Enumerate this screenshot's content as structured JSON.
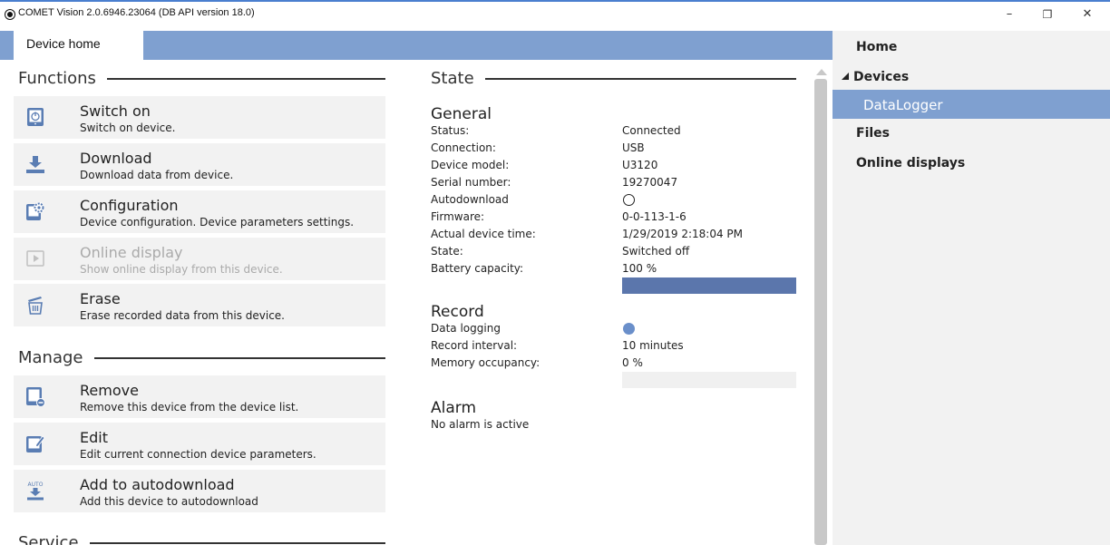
{
  "window": {
    "title": "COMET Vision 2.0.6946.23064 (DB API version 18.0)",
    "minimize_glyph": "–",
    "restore_glyph": "❐",
    "close_glyph": "✕"
  },
  "tabs": [
    {
      "label": "Device home",
      "active": true
    }
  ],
  "functions": {
    "heading": "Functions",
    "items": [
      {
        "name": "Switch on",
        "desc": "Switch on device.",
        "icon": "power-icon",
        "enabled": true
      },
      {
        "name": "Download",
        "desc": "Download data from device.",
        "icon": "download-icon",
        "enabled": true
      },
      {
        "name": "Configuration",
        "desc": "Device configuration. Device parameters settings.",
        "icon": "configuration-icon",
        "enabled": true
      },
      {
        "name": "Online display",
        "desc": "Show online display from this device.",
        "icon": "play-icon",
        "enabled": false
      },
      {
        "name": "Erase",
        "desc": "Erase recorded data from this device.",
        "icon": "erase-icon",
        "enabled": true
      }
    ]
  },
  "manage": {
    "heading": "Manage",
    "items": [
      {
        "name": "Remove",
        "desc": "Remove this device from the device list.",
        "icon": "remove-device-icon",
        "enabled": true
      },
      {
        "name": "Edit",
        "desc": "Edit current connection device parameters.",
        "icon": "edit-device-icon",
        "enabled": true
      },
      {
        "name": "Add to autodownload",
        "desc": "Add this device to autodownload",
        "icon": "autodownload-icon",
        "icon_text": "AUTO",
        "enabled": true
      }
    ]
  },
  "service": {
    "heading": "Service"
  },
  "state": {
    "heading": "State",
    "general": {
      "heading": "General",
      "status_label": "Status:",
      "status_value": "Connected",
      "connection_label": "Connection:",
      "connection_value": "USB",
      "model_label": "Device model:",
      "model_value": "U3120",
      "serial_label": "Serial number:",
      "serial_value": "19270047",
      "autodownload_label": "Autodownload",
      "autodownload_checked": false,
      "firmware_label": "Firmware:",
      "firmware_value": "0-0-113-1-6",
      "time_label": "Actual device time:",
      "time_value": "1/29/2019 2:18:04 PM",
      "state_label": "State:",
      "state_value": "Switched off",
      "battery_label": "Battery capacity:",
      "battery_value": "100 %",
      "battery_level": 1.0
    },
    "record": {
      "heading": "Record",
      "logging_label": "Data logging",
      "logging_on": true,
      "interval_label": "Record interval:",
      "interval_value": "10 minutes",
      "memory_label": "Memory occupancy:",
      "memory_value": "0 %",
      "memory_level": 0.0
    },
    "alarm": {
      "heading": "Alarm",
      "message": "No alarm is active"
    }
  },
  "nav": {
    "home": "Home",
    "devices": "Devices",
    "device_item": "DataLogger",
    "files": "Files",
    "online_displays": "Online displays"
  },
  "colors": {
    "accent": "#7fa0d0",
    "bar": "#5b76ac",
    "icon": "#5a7db3",
    "icon_disabled": "#c0c0c0",
    "panel": "#f2f2f2"
  }
}
